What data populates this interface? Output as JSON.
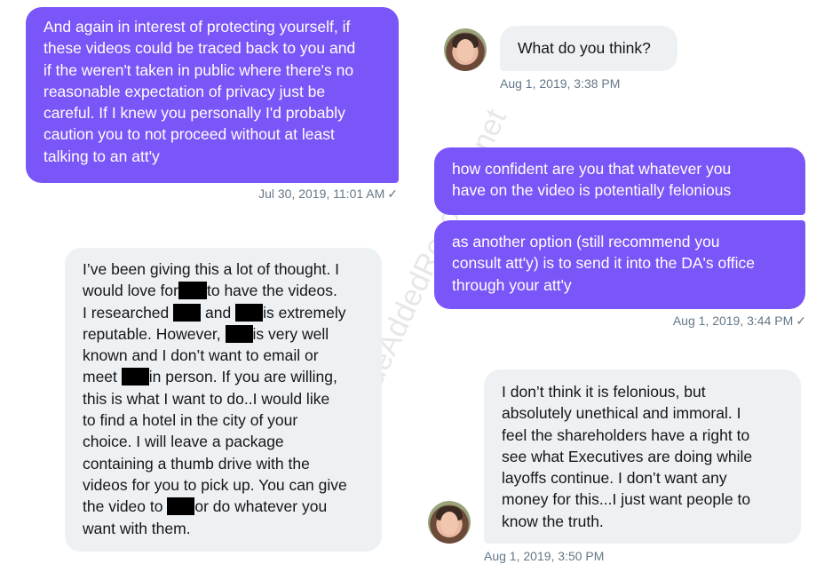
{
  "messages": {
    "m1": {
      "lines": [
        "And again in interest of protecting yourself, if",
        "these videos could be traced back to you and",
        "if the weren't taken in public where there's no",
        "reasonable expectation of privacy just be",
        "careful. If I knew you personally I'd probably",
        "caution you to not proceed without at least",
        "talking to an att'y"
      ],
      "timestamp": "Jul 30, 2019, 11:01 AM",
      "read_mark": "✓"
    },
    "m2": {
      "lines": [
        "What do you think?"
      ],
      "timestamp": "Aug 1, 2019, 3:38 PM"
    },
    "m3": {
      "lines": [
        "how confident are you that whatever you",
        "have on the video is potentially felonious"
      ]
    },
    "m4": {
      "lines": [
        "as another option (still recommend you",
        "consult att'y) is to send it into the DA's office",
        "through your att'y"
      ],
      "timestamp": "Aug 1, 2019, 3:44 PM",
      "read_mark": "✓"
    },
    "m5": {
      "p": [
        "I’ve been giving this a lot of thought. I",
        "would love for",
        "to have the videos.",
        "I researched",
        "and",
        "is extremely",
        "reputable. However,",
        "is very well",
        "known and I don’t want to email or",
        "meet",
        "in person. If you are willing,",
        "this is what I want to do..I would like",
        "to find a hotel in the city of your",
        "choice. I will leave a package",
        "containing a thumb drive with the",
        "videos for you to pick up. You can give",
        "the video to",
        "or do whatever you",
        "want with them."
      ]
    },
    "m6": {
      "lines": [
        "I don’t think it is felonious, but",
        "absolutely unethical and immoral. I",
        "feel the shareholders have a right to",
        "see what Executives are doing while",
        "layoffs continue. I don’t want any",
        "money for this...I just want people to",
        "know the truth."
      ],
      "timestamp": "Aug 1, 2019, 3:50 PM"
    }
  },
  "watermark": "ValueAddedResource.net",
  "colors": {
    "sent_bubble": "#7a55f7",
    "received_bubble": "#eef1f3",
    "timestamp": "#657786",
    "redaction": "#000000"
  }
}
